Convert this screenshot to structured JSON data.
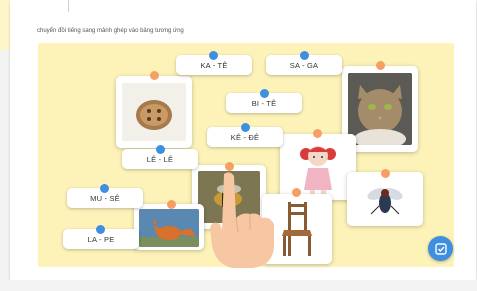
{
  "instruction": "chuyển đồi tiếng sang mảnh ghép vào bảng tương ứng",
  "pairs": [
    {
      "label": "KA - TÊ"
    },
    {
      "label": "SA - GA"
    },
    {
      "label": "BI - TÊ"
    },
    {
      "label": "KÊ - ĐÊ"
    },
    {
      "label": "LÊ - LÊ"
    },
    {
      "label": "MU - SÊ"
    },
    {
      "label": "LA - PE"
    }
  ],
  "images": [
    {
      "icon": "button-icon"
    },
    {
      "icon": "cat-icon"
    },
    {
      "icon": "doll-icon"
    },
    {
      "icon": "bee-icon"
    },
    {
      "icon": "fly-icon"
    },
    {
      "icon": "fox-icon"
    },
    {
      "icon": "chair-icon"
    }
  ],
  "submit": {
    "icon": "check-icon"
  },
  "colors": {
    "board": "#fdf3b9",
    "pin_blue": "#3e8fe0",
    "pin_orange": "#f4a064"
  }
}
